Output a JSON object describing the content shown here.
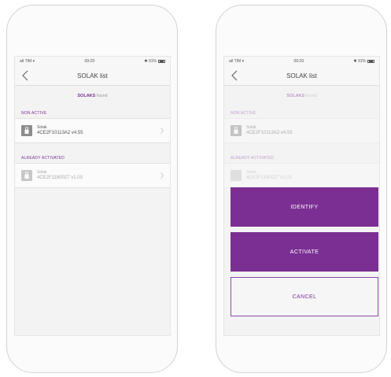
{
  "status": {
    "left": "atl TIM ▾",
    "time": "09:29",
    "battery": "✱ 91%"
  },
  "nav": {
    "title": "SOLAK list"
  },
  "found": {
    "count": "SOLAKS",
    "suffix": "found"
  },
  "sections": {
    "non_active": "NON ACTIVE",
    "already_activated": "ALREADY ACTIVATED"
  },
  "devices": [
    {
      "name": "Solak",
      "id": "4CE2F10113A2 v4.55"
    },
    {
      "name": "Solak",
      "id": "4CE2F1180027 v1.03"
    }
  ],
  "actions": {
    "identify": "IDENTIFY",
    "activate": "ACTIVATE",
    "cancel": "CANCEL"
  },
  "colors": {
    "accent": "#7b2f93"
  }
}
